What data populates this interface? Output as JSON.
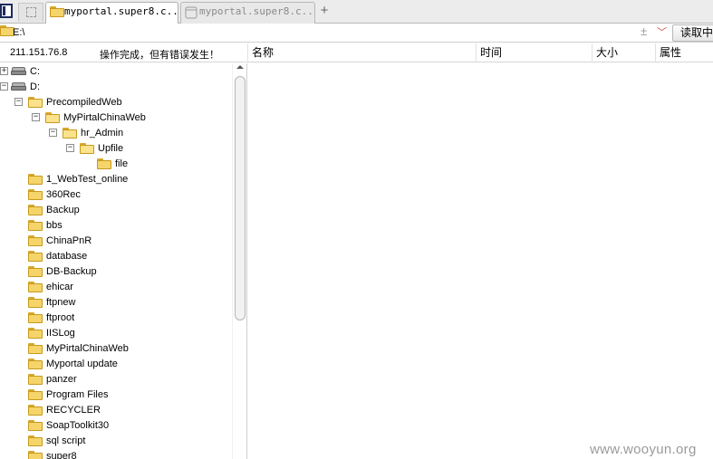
{
  "tabs": [
    {
      "label": "myportal.super8.c...",
      "active": true
    },
    {
      "label": "myportal.super8.c...",
      "active": false
    }
  ],
  "address": {
    "path": "E:\\",
    "read_button": "读取中"
  },
  "status": {
    "ip": "211.151.76.8",
    "message": "操作完成，但有错误发生！"
  },
  "columns": [
    "名称",
    "时间",
    "大小",
    "属性"
  ],
  "tree": [
    {
      "label": "C:",
      "type": "drive",
      "toggle": "+"
    },
    {
      "label": "D:",
      "type": "drive",
      "toggle": "-"
    },
    {
      "label": "PrecompiledWeb",
      "type": "folder",
      "toggle": "-"
    },
    {
      "label": "MyPirtalChinaWeb",
      "type": "folder",
      "toggle": "-"
    },
    {
      "label": "hr_Admin",
      "type": "folder",
      "toggle": "-"
    },
    {
      "label": "Upfile",
      "type": "folder",
      "toggle": "-"
    },
    {
      "label": "file",
      "type": "folder",
      "toggle": ""
    },
    {
      "label": "1_WebTest_online",
      "type": "folder",
      "toggle": ""
    },
    {
      "label": "360Rec",
      "type": "folder",
      "toggle": ""
    },
    {
      "label": "Backup",
      "type": "folder",
      "toggle": ""
    },
    {
      "label": "bbs",
      "type": "folder",
      "toggle": ""
    },
    {
      "label": "ChinaPnR",
      "type": "folder",
      "toggle": ""
    },
    {
      "label": "database",
      "type": "folder",
      "toggle": ""
    },
    {
      "label": "DB-Backup",
      "type": "folder",
      "toggle": ""
    },
    {
      "label": "ehicar",
      "type": "folder",
      "toggle": ""
    },
    {
      "label": "ftpnew",
      "type": "folder",
      "toggle": ""
    },
    {
      "label": "ftproot",
      "type": "folder",
      "toggle": ""
    },
    {
      "label": "IISLog",
      "type": "folder",
      "toggle": ""
    },
    {
      "label": "MyPirtalChinaWeb",
      "type": "folder",
      "toggle": ""
    },
    {
      "label": "Myportal update",
      "type": "folder",
      "toggle": ""
    },
    {
      "label": "panzer",
      "type": "folder",
      "toggle": ""
    },
    {
      "label": "Program Files",
      "type": "folder",
      "toggle": ""
    },
    {
      "label": "RECYCLER",
      "type": "folder",
      "toggle": ""
    },
    {
      "label": "SoapToolkit30",
      "type": "folder",
      "toggle": ""
    },
    {
      "label": "sql script",
      "type": "folder",
      "toggle": ""
    },
    {
      "label": "super8",
      "type": "folder",
      "toggle": ""
    }
  ],
  "watermark": "www.wooyun.org",
  "colors": {
    "folder": "#f5d46a",
    "folder_border": "#c69a1c",
    "tab_bar": "#ececec"
  }
}
